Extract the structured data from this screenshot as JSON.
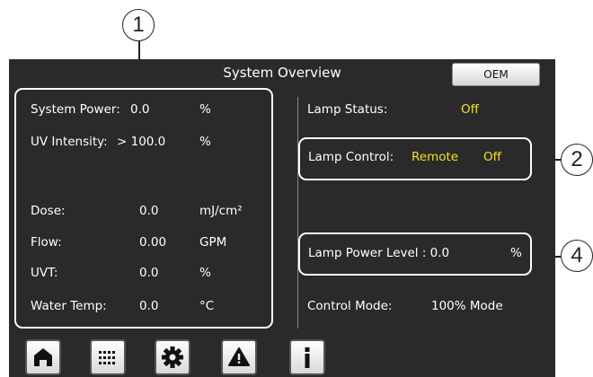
{
  "header": {
    "title": "System Overview",
    "oem_label": "OEM"
  },
  "left_panel": {
    "rows": [
      {
        "label": "System Power:",
        "value": "0.0",
        "unit": "%"
      },
      {
        "label": "UV Intensity:",
        "value": "> 100.0",
        "unit": "%"
      },
      {
        "label": "Dose:",
        "value": "0.0",
        "unit": "mJ/cm²"
      },
      {
        "label": "Flow:",
        "value": "0.00",
        "unit": "GPM"
      },
      {
        "label": "UVT:",
        "value": "0.0",
        "unit": "%"
      },
      {
        "label": "Water Temp:",
        "value": "0.0",
        "unit": "°C"
      }
    ]
  },
  "right_panel": {
    "lamp_status": {
      "label": "Lamp Status:",
      "value": "Off"
    },
    "lamp_control": {
      "label": "Lamp Control:",
      "mode": "Remote",
      "state": "Off"
    },
    "lamp_power": {
      "label": "Lamp Power Level : 0.0",
      "unit": "%"
    },
    "control_mode": {
      "label": "Control Mode:",
      "value": "100% Mode"
    }
  },
  "callouts": [
    "1",
    "2",
    "4"
  ],
  "nav": [
    {
      "icon": "home-icon"
    },
    {
      "icon": "keypad-icon"
    },
    {
      "icon": "gear-icon"
    },
    {
      "icon": "warning-icon"
    },
    {
      "icon": "info-icon"
    }
  ],
  "colors": {
    "screen_bg": "#2a2a2a",
    "text": "#ffffff",
    "accent": "#f2e21b"
  }
}
